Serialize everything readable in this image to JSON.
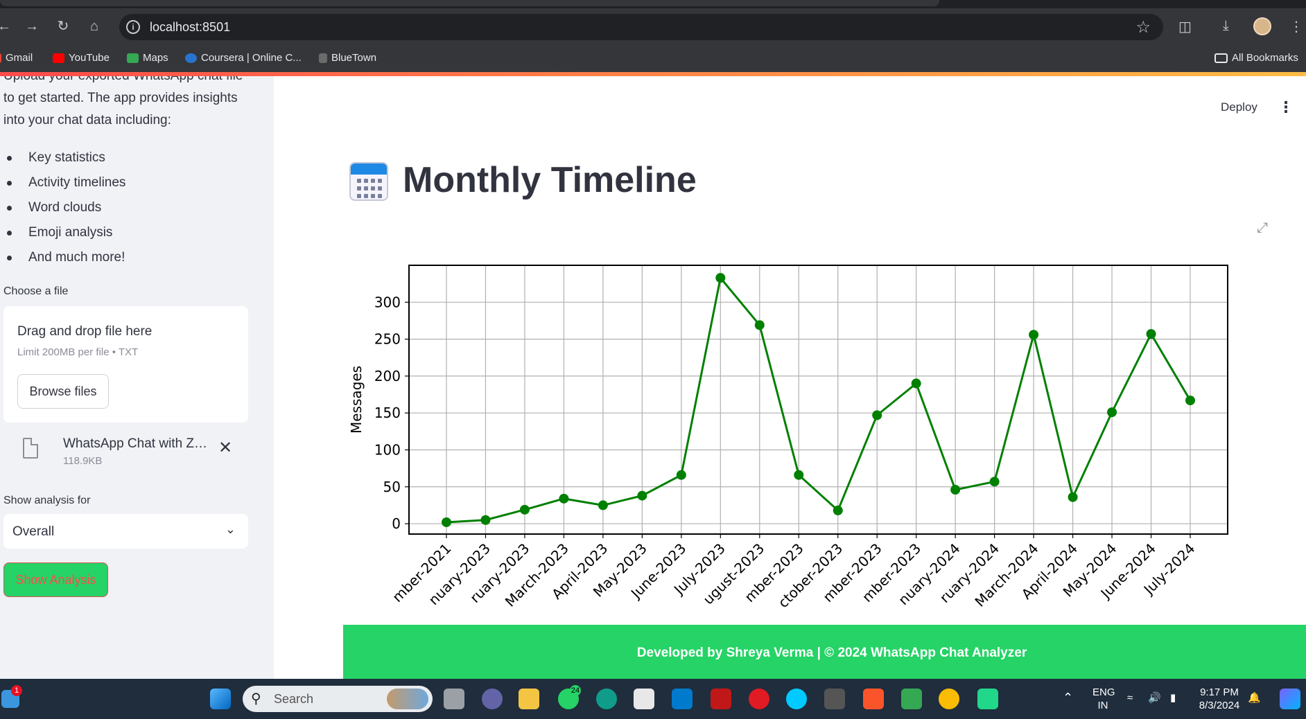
{
  "browser": {
    "url": "localhost:8501",
    "bookmarks": [
      {
        "label": "Gmail",
        "color": "#ea4335"
      },
      {
        "label": "YouTube",
        "color": "#ff0000"
      },
      {
        "label": "Maps",
        "color": "#34a853"
      },
      {
        "label": "Coursera | Online C...",
        "color": "#2a73cc"
      },
      {
        "label": "BlueTown",
        "color": "#6b6b6b"
      }
    ],
    "all_bookmarks": "All Bookmarks"
  },
  "sidebar": {
    "intro": "Upload your exported WhatsApp chat file to get started. The app provides insights into your chat data including:",
    "features": [
      "Key statistics",
      "Activity timelines",
      "Word clouds",
      "Emoji analysis",
      "And much more!"
    ],
    "file_label": "Choose a file",
    "dropzone_title": "Drag and drop file here",
    "dropzone_limit": "Limit 200MB per file • TXT",
    "browse_label": "Browse files",
    "uploaded_file_name": "WhatsApp Chat with Zo...",
    "uploaded_file_size": "118.9KB",
    "analysis_label": "Show analysis for",
    "analysis_value": "Overall",
    "show_button": "Show Analysis"
  },
  "header": {
    "deploy": "Deploy"
  },
  "main": {
    "title": "Monthly Timeline",
    "footer": "Developed by Shreya Verma | © 2024 WhatsApp Chat Analyzer"
  },
  "chart_data": {
    "type": "line",
    "categories": [
      "mber-2021",
      "nuary-2023",
      "ruary-2023",
      "March-2023",
      "April-2023",
      "May-2023",
      "June-2023",
      "July-2023",
      "ugust-2023",
      "mber-2023",
      "ctober-2023",
      "mber-2023",
      "mber-2023",
      "nuary-2024",
      "ruary-2024",
      "March-2024",
      "April-2024",
      "May-2024",
      "June-2024",
      "July-2024"
    ],
    "values": [
      2,
      5,
      19,
      34,
      25,
      38,
      66,
      333,
      269,
      66,
      18,
      147,
      190,
      46,
      57,
      256,
      36,
      151,
      257,
      167
    ],
    "ylabel": "Messages",
    "xlabel": "",
    "yticks": [
      0,
      50,
      100,
      150,
      200,
      250,
      300
    ],
    "ylim": [
      -14,
      350
    ],
    "color": "#008000",
    "grid": true
  },
  "taskbar": {
    "start_badge": "1",
    "search_placeholder": "Search",
    "whatsapp_badge": "24",
    "lang_line1": "ENG",
    "lang_line2": "IN",
    "time": "9:17 PM",
    "date": "8/3/2024"
  }
}
